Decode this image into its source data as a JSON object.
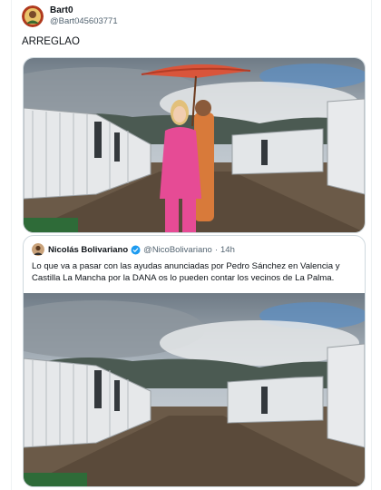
{
  "tweet": {
    "author": {
      "display_name": "Bart0",
      "handle": "@Bart045603771",
      "avatar_icon": "profile-avatar"
    },
    "text": "ARREGLAO",
    "media": {
      "alt_icon": "edited-photo-woman-with-umbrella-in-container-camp"
    }
  },
  "quoted_tweet": {
    "author": {
      "display_name": "Nicolás Bolivariano",
      "handle": "@NicoBolivariano",
      "verified_icon": "verified-badge-icon",
      "avatar_icon": "profile-avatar"
    },
    "separator": "·",
    "time": "14h",
    "text": "Lo que va a pasar con las ayudas anunciadas por Pedro Sánchez en Valencia y Castilla La Mancha por la DANA os lo pueden contar los vecinos de La Palma.",
    "media": {
      "alt_icon": "photo-container-camp"
    }
  },
  "colors": {
    "verified": "#1d9bf0",
    "muted": "#536471",
    "border": "#cfd9de"
  }
}
